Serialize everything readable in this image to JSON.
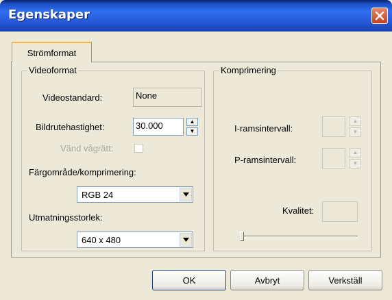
{
  "window": {
    "title": "Egenskaper"
  },
  "tabs": [
    {
      "label": "Strömformat"
    }
  ],
  "videoformat": {
    "group_title": "Videoformat",
    "videostandard_label": "Videostandard:",
    "videostandard_value": "None",
    "framerate_label": "Bildrutehastighet:",
    "framerate_value": "30.000",
    "flip_label": "Vänd vågrätt:",
    "flip_checked": false,
    "colorspace_label": "Färgområde/komprimering:",
    "colorspace_value": "RGB 24",
    "output_size_label": "Utmatningsstorlek:",
    "output_size_value": "640 x 480"
  },
  "compression": {
    "group_title": "Komprimering",
    "i_frame_label": "I-ramsintervall:",
    "i_frame_value": "",
    "p_frame_label": "P-ramsintervall:",
    "p_frame_value": "",
    "quality_label": "Kvalitet:",
    "quality_value": "",
    "quality_slider": 0.0
  },
  "buttons": {
    "ok": "OK",
    "cancel": "Avbryt",
    "apply": "Verkställ"
  },
  "colors": {
    "titlebar": "#2659d8",
    "close": "#c2401c",
    "tab_highlight": "#f6b640",
    "face": "#ece9d8"
  },
  "icons": {
    "close": "close-icon",
    "spin_up": "triangle-up-icon",
    "spin_down": "triangle-down-icon",
    "dropdown": "chevron-down-icon"
  }
}
